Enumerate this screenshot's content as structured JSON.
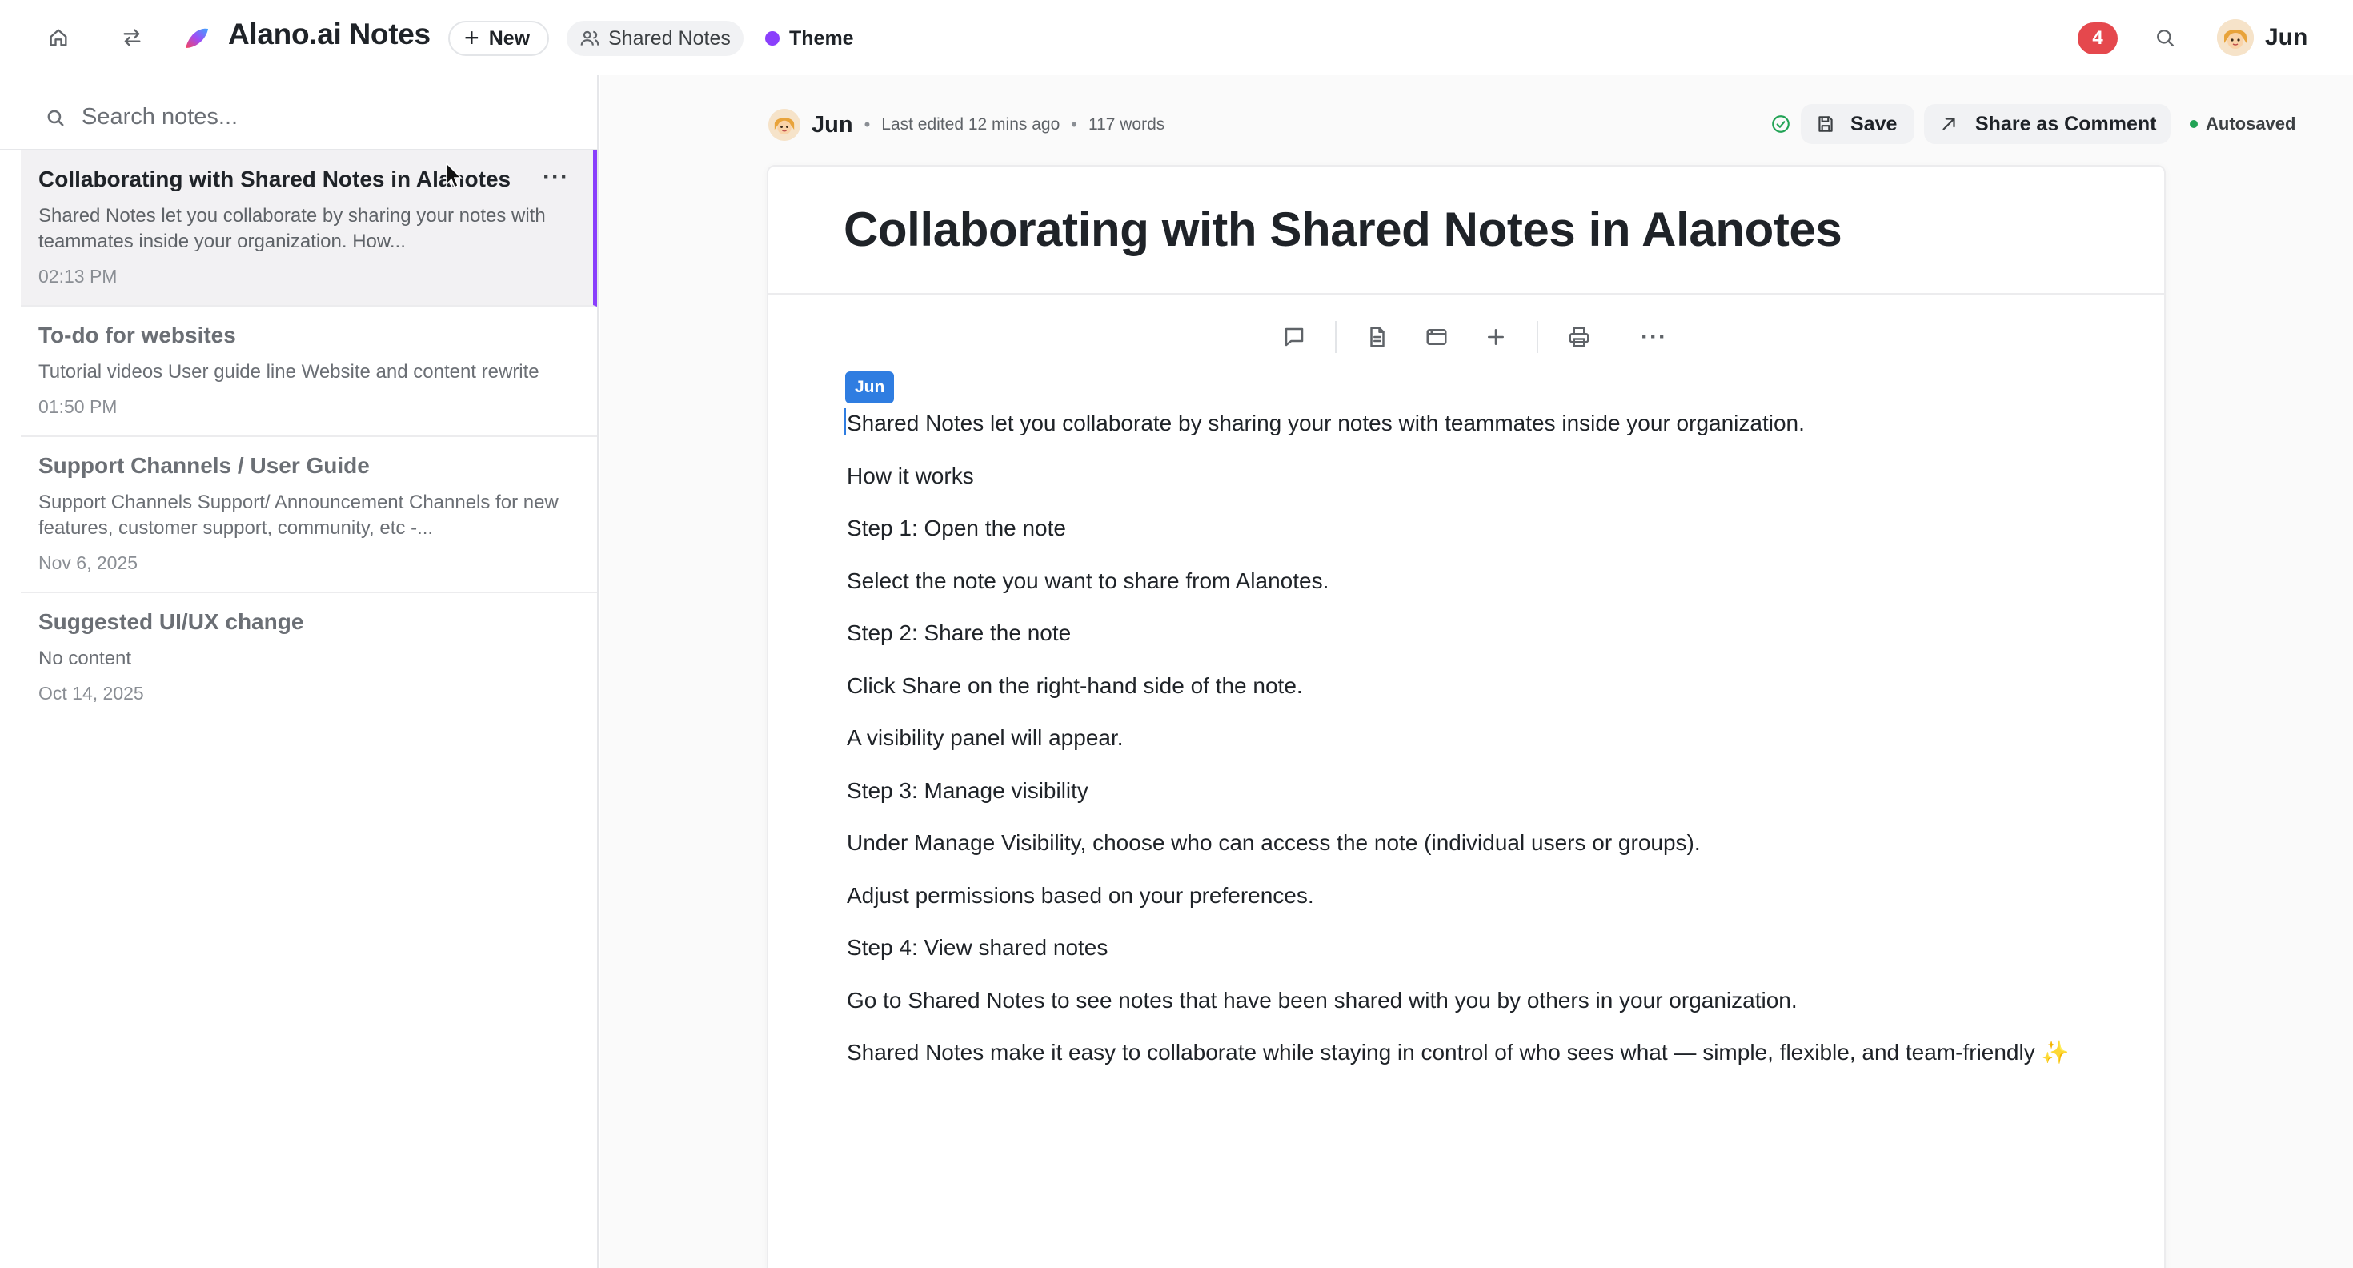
{
  "header": {
    "app_title": "Alano.ai Notes",
    "new_label": "New",
    "shared_notes_label": "Shared Notes",
    "theme_label": "Theme",
    "notification_count": "4",
    "user_name": "Jun",
    "colors": {
      "theme_dot": "#8a3ffc",
      "badge": "#e5484d"
    }
  },
  "sidebar": {
    "search_placeholder": "Search notes...",
    "notes": [
      {
        "title": "Collaborating with Shared Notes in Alanotes",
        "snippet": "Shared Notes let you collaborate by sharing your notes with teammates inside your organization. How...",
        "time": "02:13 PM",
        "active": true
      },
      {
        "title": "To-do for websites",
        "snippet": "Tutorial videos User guide line Website and content rewrite",
        "time": "01:50 PM"
      },
      {
        "title": "Support Channels / User Guide",
        "snippet": "Support Channels Support/ Announcement Channels for new features, customer support, community, etc -...",
        "time": "Nov 6, 2025"
      },
      {
        "title": "Suggested UI/UX change",
        "snippet": "No content",
        "time": "Oct 14, 2025"
      }
    ]
  },
  "editor": {
    "author": "Jun",
    "last_edited": "Last edited 12 mins ago",
    "word_count": "117 words",
    "save_label": "Save",
    "share_label": "Share as Comment",
    "autosaved_label": "Autosaved",
    "title": "Collaborating with Shared Notes in Alanotes",
    "cursor_label": "Jun",
    "paragraphs": [
      "Shared Notes let you collaborate by sharing your notes with teammates inside your organization.",
      "How it works",
      "Step 1: Open the note",
      "Select the note you want to share from Alanotes.",
      "Step 2: Share the note",
      "Click Share on the right-hand side of the note.",
      "A visibility panel will appear.",
      "Step 3: Manage visibility",
      "Under Manage Visibility, choose who can access the note (individual users or groups).",
      "Adjust permissions based on your preferences.",
      "Step 4: View shared notes",
      "Go to Shared Notes to see notes that have been shared with you by others in your organization.",
      "Shared Notes make it easy to collaborate while staying in control of who sees what — simple, flexible, and team-friendly ✨"
    ],
    "toolbar_icons": [
      "comment-icon",
      "document-icon",
      "embed-icon",
      "add-icon",
      "print-icon",
      "more-icon"
    ],
    "more_glyph": "···"
  }
}
